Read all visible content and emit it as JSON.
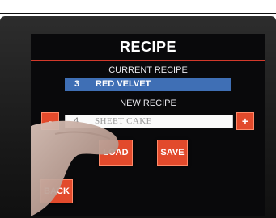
{
  "screen": {
    "title": "RECIPE",
    "current_label": "CURRENT RECIPE",
    "current_recipe": {
      "number": "3",
      "name": "RED VELVET"
    },
    "new_label": "NEW RECIPE",
    "new_recipe": {
      "number": "4",
      "name": "SHEET CAKE"
    },
    "buttons": {
      "minus": "-",
      "plus": "+",
      "load": "LOAD",
      "save": "SAVE",
      "back": "BACK"
    }
  },
  "colors": {
    "accent": "#e24a2c",
    "highlight_row": "#3f6fb5",
    "title_rule": "#d2392b",
    "screen_bg": "#09090b"
  },
  "icons": [
    "hand-pointer-icon"
  ]
}
